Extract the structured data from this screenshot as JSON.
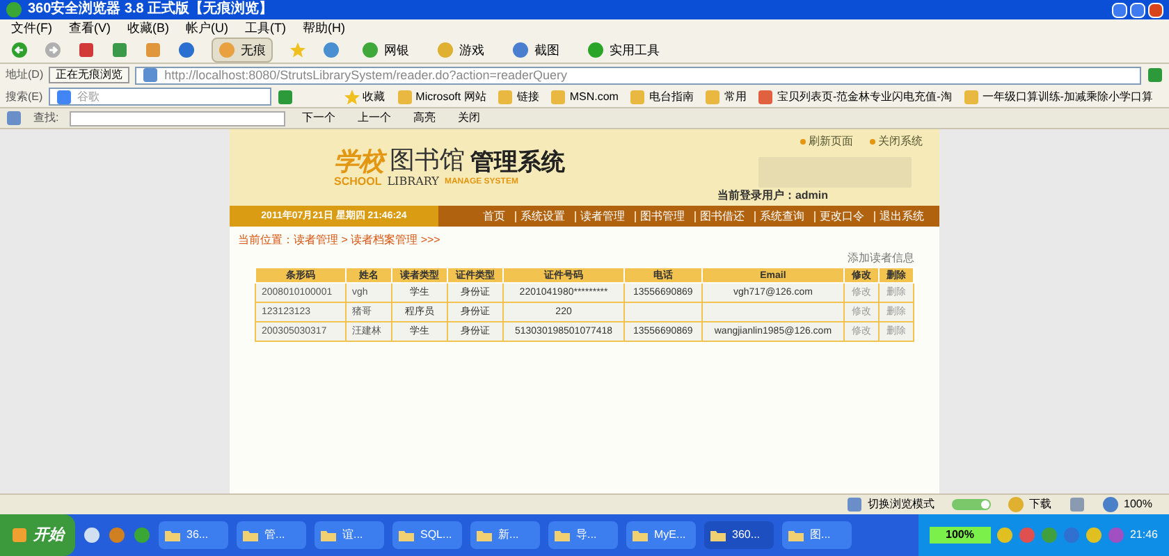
{
  "window": {
    "title": "360安全浏览器 3.8 正式版【无痕浏览】"
  },
  "menu": [
    "文件(F)",
    "查看(V)",
    "收藏(B)",
    "帐户(U)",
    "工具(T)",
    "帮助(H)"
  ],
  "toolbar": [
    "无痕",
    "网银",
    "游戏",
    "截图",
    "实用工具"
  ],
  "address": {
    "label": "地址(D)",
    "mode": "正在无痕浏览",
    "url": "http://localhost:8080/StrutsLibrarySystem/reader.do?action=readerQuery"
  },
  "search": {
    "label": "搜索(E)",
    "engine": "谷歌"
  },
  "favorites": [
    "收藏",
    "Microsoft 网站",
    "链接",
    "MSN.com",
    "电台指南",
    "常用",
    "宝贝列表页-范金林专业闪电充值-淘",
    "一年级口算训练-加减乘除小学口算"
  ],
  "find_bar": {
    "label": "查找:",
    "buttons": [
      "下一个",
      "上一个",
      "高亮",
      "关闭"
    ]
  },
  "page": {
    "top_links": [
      "刷新页面",
      "关闭系统"
    ],
    "logo": {
      "school_cn": "学校",
      "library_cn": "图书馆",
      "system_cn": "管理系统",
      "school_en": "SCHOOL",
      "library_en": "LIBRARY",
      "system_en": "MANAGE SYSTEM"
    },
    "user": "当前登录用户：admin",
    "date": "2011年07月21日 星期四 21:46:24",
    "nav": [
      "首页",
      "系统设置",
      "读者管理",
      "图书管理",
      "图书借还",
      "系统查询",
      "更改口令",
      "退出系统"
    ],
    "breadcrumb": "当前位置：读者管理 > 读者档案管理 >>>",
    "add_link": "添加读者信息",
    "table": {
      "columns": [
        "条形码",
        "姓名",
        "读者类型",
        "证件类型",
        "证件号码",
        "电话",
        "Email",
        "修改",
        "删除"
      ],
      "rows": [
        [
          "2008010100001",
          "vgh",
          "学生",
          "身份证",
          "2201041980*********",
          "13556690869",
          "vgh717@126.com",
          "修改",
          "删除"
        ],
        [
          "123123123",
          "猪哥",
          "程序员",
          "身份证",
          "220",
          "",
          "",
          "修改",
          "删除"
        ],
        [
          "200305030317",
          "汪建林",
          "学生",
          "身份证",
          "513030198501077418",
          "13556690869",
          "wangjianlin1985@126.com",
          "修改",
          "删除"
        ]
      ]
    }
  },
  "status_bar": {
    "mode": "切换浏览模式",
    "mode_toggle_on": true,
    "download": "下载",
    "zoom": "100%"
  },
  "taskbar": {
    "start": "开始",
    "tasks": [
      {
        "label": "36...",
        "selected": false
      },
      {
        "label": "管...",
        "selected": false
      },
      {
        "label": "谊...",
        "selected": false
      },
      {
        "label": "SQL...",
        "selected": false
      },
      {
        "label": "新...",
        "selected": false
      },
      {
        "label": "导...",
        "selected": false
      },
      {
        "label": "MyE...",
        "selected": false
      },
      {
        "label": "360...",
        "selected": true
      },
      {
        "label": "图...",
        "selected": false
      }
    ],
    "battery": "100%",
    "clock": "21:46"
  }
}
